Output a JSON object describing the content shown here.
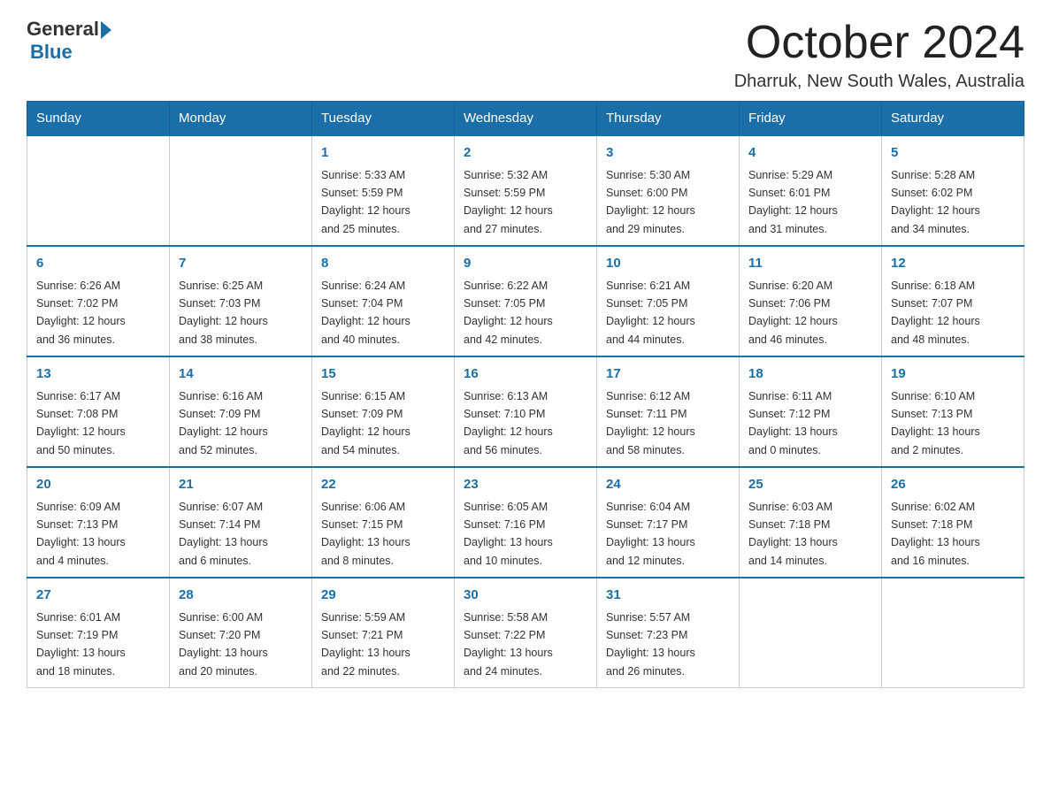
{
  "header": {
    "logo_general": "General",
    "logo_blue": "Blue",
    "month_title": "October 2024",
    "location": "Dharruk, New South Wales, Australia"
  },
  "weekdays": [
    "Sunday",
    "Monday",
    "Tuesday",
    "Wednesday",
    "Thursday",
    "Friday",
    "Saturday"
  ],
  "weeks": [
    [
      {
        "day": "",
        "info": ""
      },
      {
        "day": "",
        "info": ""
      },
      {
        "day": "1",
        "info": "Sunrise: 5:33 AM\nSunset: 5:59 PM\nDaylight: 12 hours\nand 25 minutes."
      },
      {
        "day": "2",
        "info": "Sunrise: 5:32 AM\nSunset: 5:59 PM\nDaylight: 12 hours\nand 27 minutes."
      },
      {
        "day": "3",
        "info": "Sunrise: 5:30 AM\nSunset: 6:00 PM\nDaylight: 12 hours\nand 29 minutes."
      },
      {
        "day": "4",
        "info": "Sunrise: 5:29 AM\nSunset: 6:01 PM\nDaylight: 12 hours\nand 31 minutes."
      },
      {
        "day": "5",
        "info": "Sunrise: 5:28 AM\nSunset: 6:02 PM\nDaylight: 12 hours\nand 34 minutes."
      }
    ],
    [
      {
        "day": "6",
        "info": "Sunrise: 6:26 AM\nSunset: 7:02 PM\nDaylight: 12 hours\nand 36 minutes."
      },
      {
        "day": "7",
        "info": "Sunrise: 6:25 AM\nSunset: 7:03 PM\nDaylight: 12 hours\nand 38 minutes."
      },
      {
        "day": "8",
        "info": "Sunrise: 6:24 AM\nSunset: 7:04 PM\nDaylight: 12 hours\nand 40 minutes."
      },
      {
        "day": "9",
        "info": "Sunrise: 6:22 AM\nSunset: 7:05 PM\nDaylight: 12 hours\nand 42 minutes."
      },
      {
        "day": "10",
        "info": "Sunrise: 6:21 AM\nSunset: 7:05 PM\nDaylight: 12 hours\nand 44 minutes."
      },
      {
        "day": "11",
        "info": "Sunrise: 6:20 AM\nSunset: 7:06 PM\nDaylight: 12 hours\nand 46 minutes."
      },
      {
        "day": "12",
        "info": "Sunrise: 6:18 AM\nSunset: 7:07 PM\nDaylight: 12 hours\nand 48 minutes."
      }
    ],
    [
      {
        "day": "13",
        "info": "Sunrise: 6:17 AM\nSunset: 7:08 PM\nDaylight: 12 hours\nand 50 minutes."
      },
      {
        "day": "14",
        "info": "Sunrise: 6:16 AM\nSunset: 7:09 PM\nDaylight: 12 hours\nand 52 minutes."
      },
      {
        "day": "15",
        "info": "Sunrise: 6:15 AM\nSunset: 7:09 PM\nDaylight: 12 hours\nand 54 minutes."
      },
      {
        "day": "16",
        "info": "Sunrise: 6:13 AM\nSunset: 7:10 PM\nDaylight: 12 hours\nand 56 minutes."
      },
      {
        "day": "17",
        "info": "Sunrise: 6:12 AM\nSunset: 7:11 PM\nDaylight: 12 hours\nand 58 minutes."
      },
      {
        "day": "18",
        "info": "Sunrise: 6:11 AM\nSunset: 7:12 PM\nDaylight: 13 hours\nand 0 minutes."
      },
      {
        "day": "19",
        "info": "Sunrise: 6:10 AM\nSunset: 7:13 PM\nDaylight: 13 hours\nand 2 minutes."
      }
    ],
    [
      {
        "day": "20",
        "info": "Sunrise: 6:09 AM\nSunset: 7:13 PM\nDaylight: 13 hours\nand 4 minutes."
      },
      {
        "day": "21",
        "info": "Sunrise: 6:07 AM\nSunset: 7:14 PM\nDaylight: 13 hours\nand 6 minutes."
      },
      {
        "day": "22",
        "info": "Sunrise: 6:06 AM\nSunset: 7:15 PM\nDaylight: 13 hours\nand 8 minutes."
      },
      {
        "day": "23",
        "info": "Sunrise: 6:05 AM\nSunset: 7:16 PM\nDaylight: 13 hours\nand 10 minutes."
      },
      {
        "day": "24",
        "info": "Sunrise: 6:04 AM\nSunset: 7:17 PM\nDaylight: 13 hours\nand 12 minutes."
      },
      {
        "day": "25",
        "info": "Sunrise: 6:03 AM\nSunset: 7:18 PM\nDaylight: 13 hours\nand 14 minutes."
      },
      {
        "day": "26",
        "info": "Sunrise: 6:02 AM\nSunset: 7:18 PM\nDaylight: 13 hours\nand 16 minutes."
      }
    ],
    [
      {
        "day": "27",
        "info": "Sunrise: 6:01 AM\nSunset: 7:19 PM\nDaylight: 13 hours\nand 18 minutes."
      },
      {
        "day": "28",
        "info": "Sunrise: 6:00 AM\nSunset: 7:20 PM\nDaylight: 13 hours\nand 20 minutes."
      },
      {
        "day": "29",
        "info": "Sunrise: 5:59 AM\nSunset: 7:21 PM\nDaylight: 13 hours\nand 22 minutes."
      },
      {
        "day": "30",
        "info": "Sunrise: 5:58 AM\nSunset: 7:22 PM\nDaylight: 13 hours\nand 24 minutes."
      },
      {
        "day": "31",
        "info": "Sunrise: 5:57 AM\nSunset: 7:23 PM\nDaylight: 13 hours\nand 26 minutes."
      },
      {
        "day": "",
        "info": ""
      },
      {
        "day": "",
        "info": ""
      }
    ]
  ]
}
